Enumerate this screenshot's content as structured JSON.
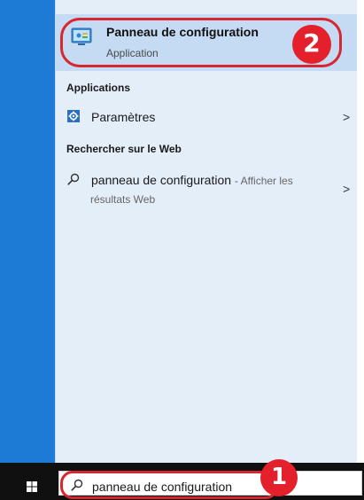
{
  "best_match": {
    "title": "Panneau de configuration",
    "subtitle": "Application",
    "icon": "control-panel-icon"
  },
  "sections": {
    "apps_header": "Applications",
    "web_header": "Rechercher sur le Web"
  },
  "apps": [
    {
      "label": "Paramètres",
      "icon": "gear-icon",
      "chevron": ">"
    }
  ],
  "web_results": [
    {
      "query": "panneau de configuration",
      "suffix": "- Afficher les",
      "suffix_line2": "résultats Web",
      "icon": "search-icon",
      "chevron": ">"
    }
  ],
  "taskbar": {
    "search_value": "panneau de configuration",
    "start_icon": "windows-logo-icon"
  },
  "annotations": {
    "callout_top": "2",
    "callout_bottom": "1",
    "accent_color": "#e3202b"
  },
  "colors": {
    "start_rail": "#1d7bd6",
    "panel_bg": "#e3eef9",
    "selected_bg": "#c4dbf3",
    "taskbar_bg": "#101010"
  }
}
